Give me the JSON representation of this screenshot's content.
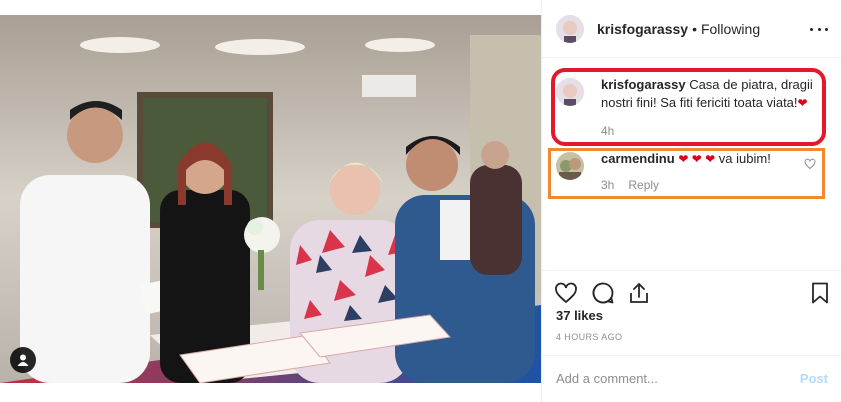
{
  "post": {
    "image_alt": "Wedding photo",
    "user_tag_icon": "user-tag-icon"
  },
  "header": {
    "username": "krisfogarassy",
    "separator": "•",
    "follow_status": "Following",
    "more_icon": "ellipsis-icon"
  },
  "comments": [
    {
      "username": "krisfogarassy",
      "text": "Casa de piatra, dragii nostri fini! Sa fiti fericiti toata viata!",
      "emoji": "❤",
      "time": "4h",
      "reply": ""
    },
    {
      "username": "carmendinu",
      "emoji": "❤ ❤ ❤",
      "text": "va iubim!",
      "time": "3h",
      "reply": "Reply"
    }
  ],
  "actions": {
    "like_icon": "heart-outline-icon",
    "comment_icon": "comment-icon",
    "share_icon": "share-icon",
    "save_icon": "bookmark-icon"
  },
  "likes": "37 likes",
  "posted_time": "4 HOURS AGO",
  "add_comment": {
    "placeholder": "Add a comment...",
    "post_label": "Post"
  },
  "colors": {
    "highlight_red": "#e3182a",
    "highlight_orange": "#f0892f",
    "heart": "#d8001c",
    "post_disabled": "#b3dbff"
  }
}
